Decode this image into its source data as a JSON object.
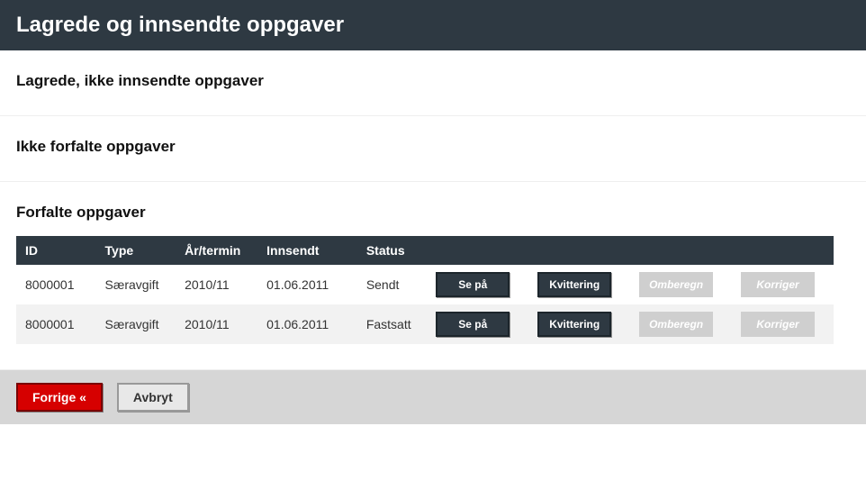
{
  "header": {
    "title": "Lagrede og innsendte oppgaver"
  },
  "sections": {
    "saved": {
      "title": "Lagrede, ikke innsendte oppgaver"
    },
    "notdue": {
      "title": "Ikke forfalte oppgaver"
    },
    "due": {
      "title": "Forfalte oppgaver"
    }
  },
  "table": {
    "headers": {
      "id": "ID",
      "type": "Type",
      "term": "År/termin",
      "submitted": "Innsendt",
      "status": "Status"
    },
    "buttons": {
      "view": "Se på",
      "receipt": "Kvittering",
      "recalc": "Omberegn",
      "correct": "Korriger"
    },
    "rows": [
      {
        "id": "8000001",
        "type": "Særavgift",
        "term": "2010/11",
        "submitted": "01.06.2011",
        "status": "Sendt"
      },
      {
        "id": "8000001",
        "type": "Særavgift",
        "term": "2010/11",
        "submitted": "01.06.2011",
        "status": "Fastsatt"
      }
    ]
  },
  "footer": {
    "prev": "Forrige «",
    "cancel": "Avbryt"
  }
}
